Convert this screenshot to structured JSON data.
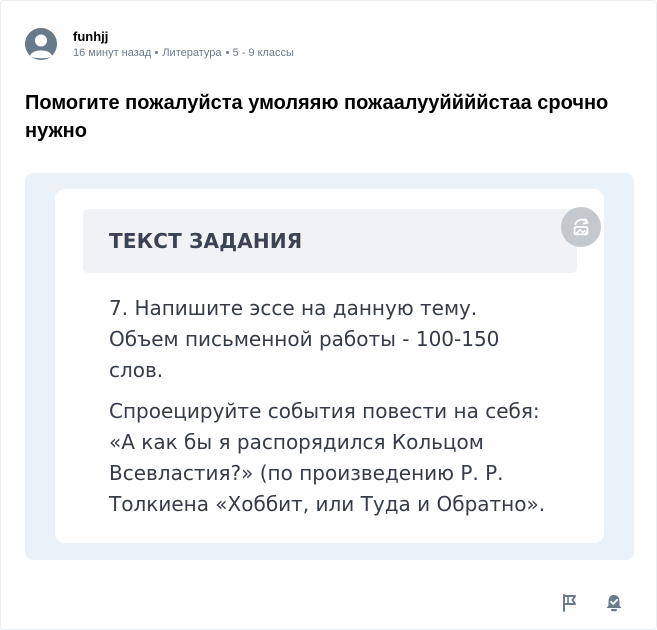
{
  "post": {
    "author": "funhjj",
    "time_ago": "16 минут назад",
    "subject": "Литература",
    "grade": "5 - 9 классы",
    "question": "Помогите пожалуйста умоляяю пожаалууййййстаа срочно нужно"
  },
  "attachment": {
    "header": "ТЕКСТ ЗАДАНИЯ",
    "paragraph1": "7. Напишите эссе на данную тему.\nОбъем письменной работы - 100-150\nслов.",
    "paragraph2": "Спроецируйте события повести на себя:\n«А как бы я распорядился Кольцом\nВсевластия?» (по произведению Р. Р.\nТолкиена «Хоббит, или Туда и Обратно»."
  },
  "icons": {
    "avatar": "default-avatar-icon",
    "rotate": "rotate-image-icon",
    "report": "flag-icon",
    "follow": "bell-check-icon"
  },
  "colors": {
    "meta_text": "#687b8c",
    "attachment_bg": "#ebf2f7",
    "icon": "#687b8c"
  }
}
